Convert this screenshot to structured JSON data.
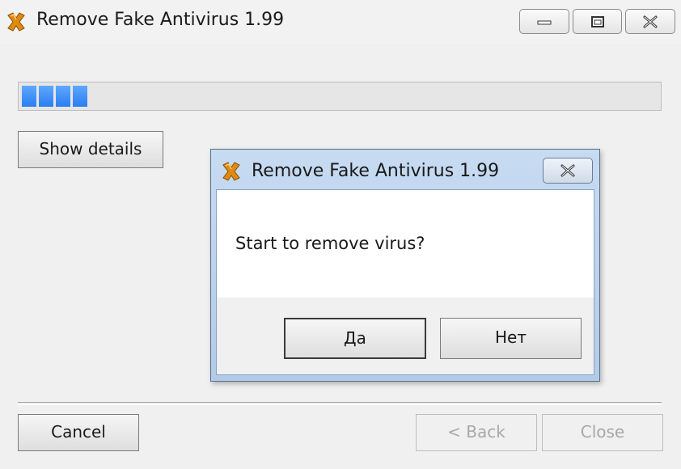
{
  "window": {
    "title": "Remove Fake Antivirus 1.99",
    "icon": "app-x-icon"
  },
  "progress": {
    "segments_filled": 4
  },
  "buttons": {
    "show_details": "Show details",
    "cancel": "Cancel",
    "back": "< Back",
    "close": "Close"
  },
  "dialog": {
    "title": "Remove Fake Antivirus 1.99",
    "message": "Start to remove virus?",
    "yes_label": "Да",
    "no_label": "Нет"
  },
  "colors": {
    "progress_fill": "#2a7ef0",
    "icon_orange": "#e08a12"
  }
}
